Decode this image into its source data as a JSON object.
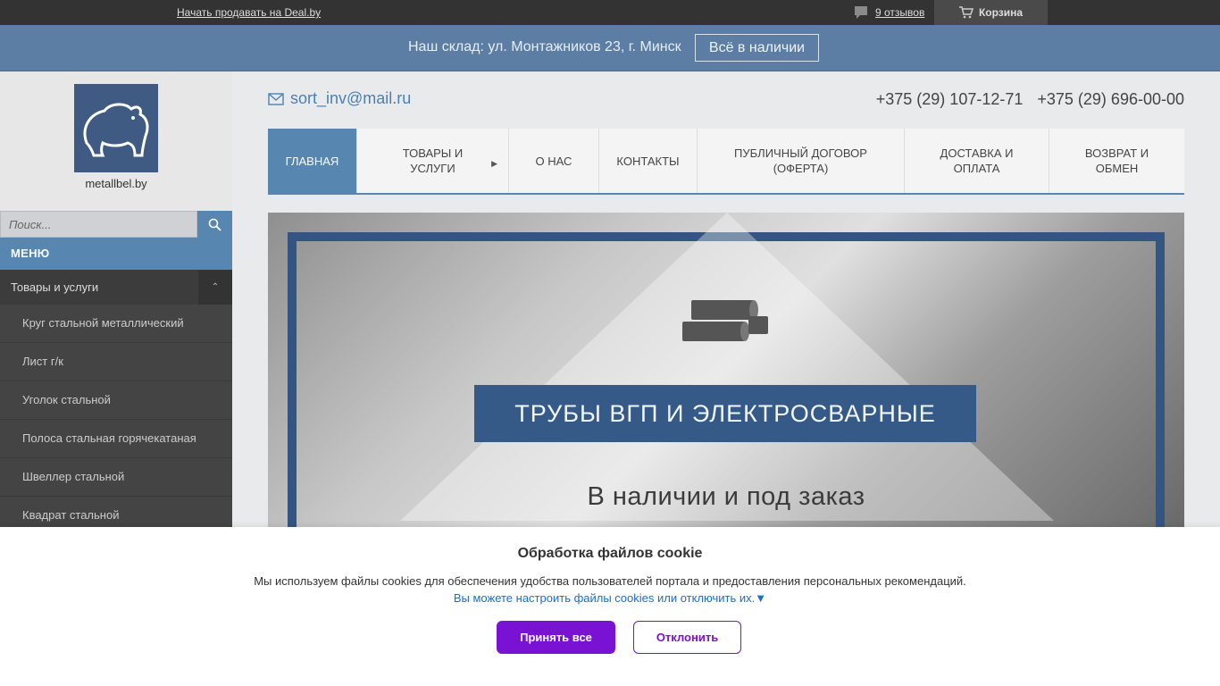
{
  "topbar": {
    "sell_link": "Начать продавать на Deal.by",
    "reviews_label": "9 отзывов",
    "cart_label": "Корзина"
  },
  "strip": {
    "address": "Наш склад: ул. Монтажников 23, г. Минск",
    "stock_button": "Всё в наличии"
  },
  "sidebar": {
    "logo_name": "metallbel.by",
    "search_placeholder": "Поиск...",
    "menu_title": "МЕНЮ",
    "parent_item": "Товары и услуги",
    "items": [
      "Круг стальной металлический",
      "Лист г/к",
      "Уголок стальной",
      "Полоса стальная горячекатаная",
      "Швеллер стальной",
      "Квадрат стальной"
    ]
  },
  "header": {
    "email": "sort_inv@mail.ru",
    "phone1": "+375 (29) 107-12-71",
    "phone2": "+375 (29) 696-00-00"
  },
  "nav": {
    "tabs": [
      "Главная",
      "Товары и услуги",
      "О нас",
      "Контакты",
      "Публичный договор (оферта)",
      "Доставка и оплата",
      "Возврат и обмен"
    ]
  },
  "banner": {
    "title": "ТРУБЫ ВГП И ЭЛЕКТРОСВАРНЫЕ",
    "subtitle": "В наличии и под заказ"
  },
  "cookie": {
    "title": "Обработка файлов cookie",
    "text": "Мы используем файлы cookies для обеспечения удобства пользователей портала и предоставления персональных рекомендаций.",
    "link": "Вы можете настроить файлы cookies или отключить их.▼",
    "accept": "Принять все",
    "decline": "Отклонить"
  },
  "colors": {
    "accent": "#5786b0",
    "strip": "#5d7ea4",
    "cookie_button": "#7a12d4"
  }
}
